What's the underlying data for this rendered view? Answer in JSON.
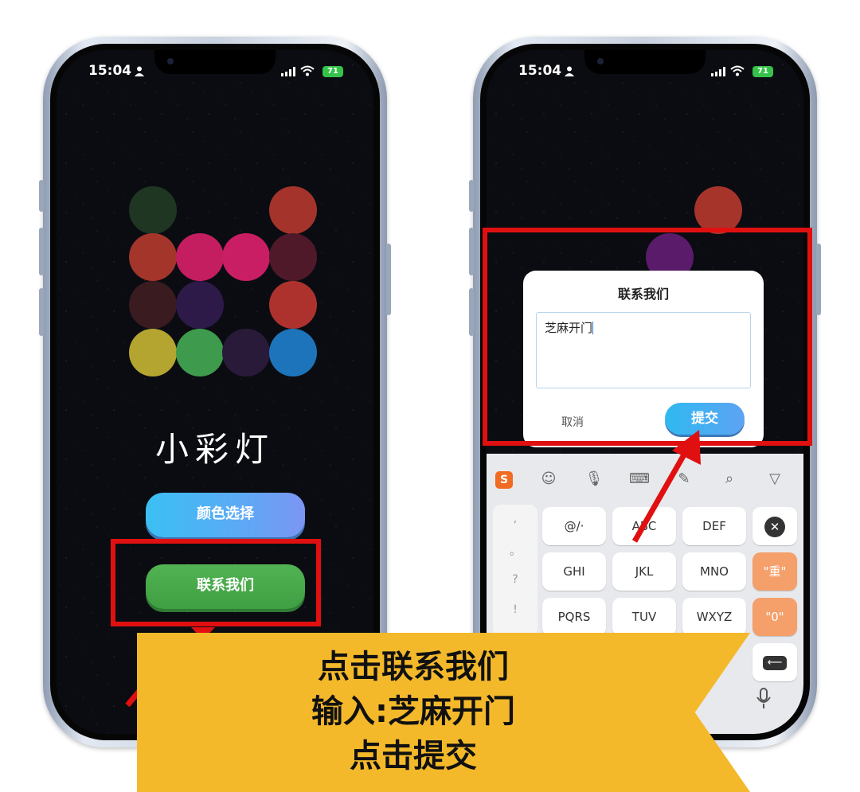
{
  "status_bar": {
    "time": "15:04",
    "battery": "71"
  },
  "left_screen": {
    "app_title": "小彩灯",
    "color_button": "颜色选择",
    "contact_button": "联系我们",
    "dot_colors": [
      "#233a24",
      "#a0332b",
      "#a03128",
      "#c01f60",
      "#c51f62",
      "#531a2b",
      "#3b1b21",
      "#2e1a4b",
      "#ab322d",
      "#b3a42f",
      "#3d9a4b",
      "#2a1b3b",
      "#1b73b9"
    ]
  },
  "right_screen": {
    "dialog_title": "联系我们",
    "input_value": "芝麻开门",
    "cancel_label": "取消",
    "submit_label": "提交",
    "keys": [
      "@/·",
      "ABC",
      "DEF",
      "GHI",
      "JKL",
      "MNO",
      "PQRS",
      "TUV",
      "WXYZ"
    ],
    "punctuation": [
      ",",
      "。",
      "?",
      "!"
    ],
    "special_keys": [
      "\"重\"",
      "\"0\""
    ],
    "toolbar_icons": [
      "sogou-logo-icon",
      "emoji-icon",
      "mic-icon",
      "keyboard-icon",
      "handwriting-icon",
      "search-icon",
      "collapse-icon"
    ]
  },
  "banner": {
    "line1": "点击联系我们",
    "line2": "输入:芝麻开门",
    "line3": "点击提交"
  },
  "colors": {
    "highlight": "#e01010",
    "banner": "#f4b92a"
  }
}
